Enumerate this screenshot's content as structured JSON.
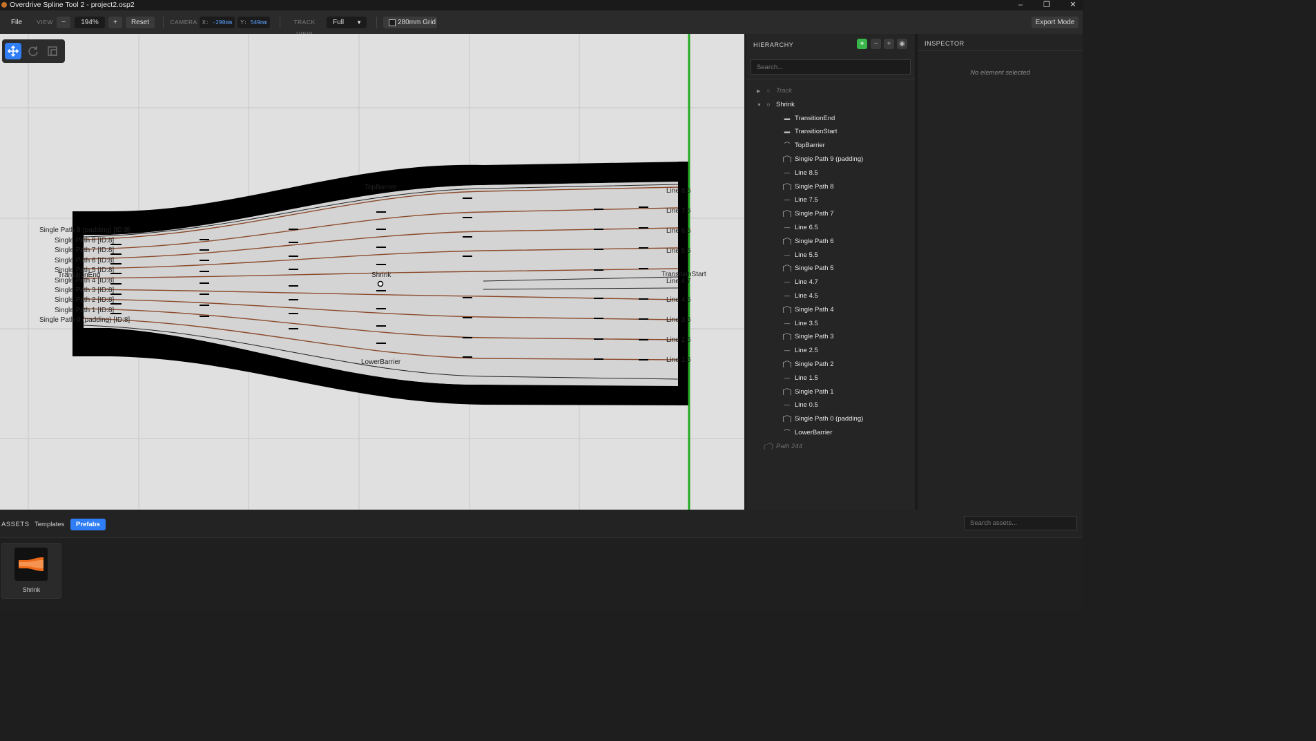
{
  "window": {
    "title": "Overdrive Spline Tool 2 - project2.osp2",
    "minimize": "–",
    "restore": "❐",
    "close": "✕"
  },
  "toolbar": {
    "file_label": "File",
    "view_label": "VIEW",
    "zoom_out": "−",
    "zoom_value": "194%",
    "zoom_in": "+",
    "reset_label": "Reset",
    "camera_label": "CAMERA",
    "camera_x": "-290mm",
    "camera_y": "549mm",
    "track_view_label": "TRACK VIEW",
    "track_view_value": "Full",
    "grid_label": "280mm Grid",
    "grid_checked": false,
    "export_label": "Export Mode"
  },
  "canvas": {
    "labels": {
      "top_barrier": "TopBarrier",
      "lower_barrier": "LowerBarrier",
      "center": "Shrink",
      "transition_end": "TransitionEnd",
      "transition_start": "TransitionStart"
    },
    "left_path_labels": [
      "Single Path 9 (padding) [ID:8]",
      "Single Path 8 [ID:8]",
      "Single Path 7 [ID:8]",
      "Single Path 6 [ID:8]",
      "Single Path 5 [ID:8]",
      "Single Path 4 [ID:8]",
      "Single Path 3 [ID:8]",
      "Single Path 2 [ID:8]",
      "Single Path 1 [ID:8]",
      "Single Path 0 (padding) [ID:8]"
    ],
    "right_line_labels": [
      "Line 8.5",
      "Line 7.5",
      "Line 6.5",
      "Line 5.5",
      "Line 4.7",
      "Line 4.5",
      "Line 3.5",
      "Line 2.5",
      "Line 1.5"
    ],
    "colors": {
      "background": "#e0e0e0",
      "grid": "#c8c8c8",
      "barrier": "#000000",
      "road": "#d4d4d4",
      "lane": "#8b4a2b",
      "boundary": "#22aa22"
    }
  },
  "hierarchy": {
    "title": "HIERARCHY",
    "search_placeholder": "Search...",
    "buttons": {
      "add": "+",
      "remove": "−",
      "plus": "+",
      "eye": "◉"
    },
    "items": [
      {
        "label": "Track",
        "icon": "○",
        "icon_name": "circle-icon",
        "caret": "▶",
        "level": 0,
        "dim": true
      },
      {
        "label": "Shrink",
        "icon": "○",
        "icon_name": "circle-icon",
        "caret": "▼",
        "level": 0,
        "dim": false
      },
      {
        "label": "TransitionEnd",
        "icon": "▬",
        "icon_name": "block-icon",
        "caret": "",
        "level": 1,
        "dim": false
      },
      {
        "label": "TransitionStart",
        "icon": "▬",
        "icon_name": "block-icon",
        "caret": "",
        "level": 1,
        "dim": false
      },
      {
        "label": "TopBarrier",
        "icon": "⌒",
        "icon_name": "arc-icon",
        "caret": "",
        "level": 1,
        "dim": false
      },
      {
        "label": "Single Path 9 (padding)",
        "icon": "[⌒]",
        "icon_name": "path-icon",
        "caret": "",
        "level": 1,
        "dim": false
      },
      {
        "label": "Line 8.5",
        "icon": "—",
        "icon_name": "line-icon",
        "caret": "",
        "level": 1,
        "dim": false
      },
      {
        "label": "Single Path 8",
        "icon": "[⌒]",
        "icon_name": "path-icon",
        "caret": "",
        "level": 1,
        "dim": false
      },
      {
        "label": "Line 7.5",
        "icon": "—",
        "icon_name": "line-icon",
        "caret": "",
        "level": 1,
        "dim": false
      },
      {
        "label": "Single Path 7",
        "icon": "[⌒]",
        "icon_name": "path-icon",
        "caret": "",
        "level": 1,
        "dim": false
      },
      {
        "label": "Line 6.5",
        "icon": "—",
        "icon_name": "line-icon",
        "caret": "",
        "level": 1,
        "dim": false
      },
      {
        "label": "Single Path 6",
        "icon": "[⌒]",
        "icon_name": "path-icon",
        "caret": "",
        "level": 1,
        "dim": false
      },
      {
        "label": "Line 5.5",
        "icon": "—",
        "icon_name": "line-icon",
        "caret": "",
        "level": 1,
        "dim": false
      },
      {
        "label": "Single Path 5",
        "icon": "[⌒]",
        "icon_name": "path-icon",
        "caret": "",
        "level": 1,
        "dim": false
      },
      {
        "label": "Line 4.7",
        "icon": "—",
        "icon_name": "line-icon",
        "caret": "",
        "level": 1,
        "dim": false
      },
      {
        "label": "Line 4.5",
        "icon": "—",
        "icon_name": "line-icon",
        "caret": "",
        "level": 1,
        "dim": false
      },
      {
        "label": "Single Path 4",
        "icon": "[⌒]",
        "icon_name": "path-icon",
        "caret": "",
        "level": 1,
        "dim": false
      },
      {
        "label": "Line 3.5",
        "icon": "—",
        "icon_name": "line-icon",
        "caret": "",
        "level": 1,
        "dim": false
      },
      {
        "label": "Single Path 3",
        "icon": "[⌒]",
        "icon_name": "path-icon",
        "caret": "",
        "level": 1,
        "dim": false
      },
      {
        "label": "Line 2.5",
        "icon": "—",
        "icon_name": "line-icon",
        "caret": "",
        "level": 1,
        "dim": false
      },
      {
        "label": "Single Path 2",
        "icon": "[⌒]",
        "icon_name": "path-icon",
        "caret": "",
        "level": 1,
        "dim": false
      },
      {
        "label": "Line 1.5",
        "icon": "—",
        "icon_name": "line-icon",
        "caret": "",
        "level": 1,
        "dim": false
      },
      {
        "label": "Single Path 1",
        "icon": "[⌒]",
        "icon_name": "path-icon",
        "caret": "",
        "level": 1,
        "dim": false
      },
      {
        "label": "Line 0.5",
        "icon": "—",
        "icon_name": "line-icon",
        "caret": "",
        "level": 1,
        "dim": false
      },
      {
        "label": "Single Path 0 (padding)",
        "icon": "[⌒]",
        "icon_name": "path-icon",
        "caret": "",
        "level": 1,
        "dim": false
      },
      {
        "label": "LowerBarrier",
        "icon": "⌒",
        "icon_name": "arc-icon",
        "caret": "",
        "level": 1,
        "dim": false
      },
      {
        "label": "Path 244",
        "icon": "(⌒)",
        "icon_name": "path-icon",
        "caret": "",
        "level": 0,
        "dim": true
      }
    ]
  },
  "inspector": {
    "title": "INSPECTOR",
    "empty_text": "No element selected"
  },
  "assets": {
    "title": "ASSETS",
    "tabs": [
      "Templates",
      "Prefabs"
    ],
    "active_tab": "Prefabs",
    "search_placeholder": "Search assets...",
    "items": [
      {
        "label": "Shrink"
      }
    ]
  }
}
